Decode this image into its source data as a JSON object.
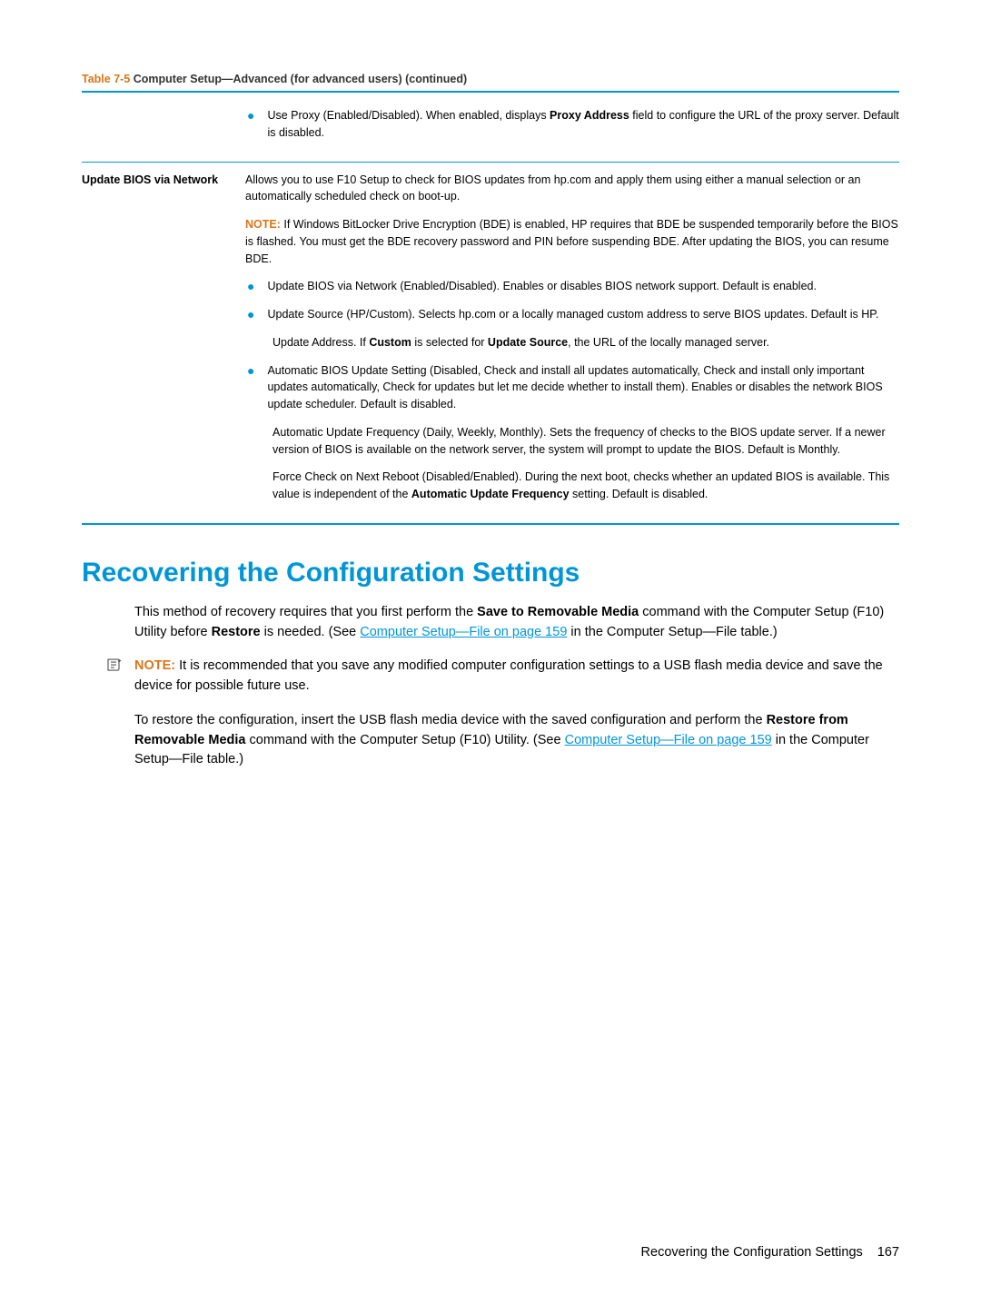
{
  "tableCaption": {
    "prefix": "Table 7-5",
    "title": "  Computer Setup—Advanced (for advanced users) (continued)"
  },
  "row1": {
    "bullet1": {
      "pre": "Use Proxy (Enabled/Disabled). When enabled, displays ",
      "bold": "Proxy Address",
      "post": " field to configure the URL of the proxy server. Default is disabled."
    }
  },
  "row2": {
    "label": "Update BIOS via Network",
    "intro": "Allows you to use F10 Setup to check for BIOS updates from hp.com and apply them using either a manual selection or an automatically scheduled check on boot-up.",
    "noteLabel": "NOTE:",
    "noteText": "   If Windows BitLocker Drive Encryption (BDE) is enabled, HP requires that BDE be suspended temporarily before the BIOS is flashed. You must get the BDE recovery password and PIN before suspending BDE. After updating the BIOS, you can resume BDE.",
    "b1": "Update BIOS via Network (Enabled/Disabled). Enables or disables BIOS network support. Default is enabled.",
    "b2": "Update Source (HP/Custom). Selects hp.com or a locally managed custom address to serve BIOS updates. Default is HP.",
    "addr": {
      "pre": "Update Address. If ",
      "b1": "Custom",
      "mid": " is selected for ",
      "b2": "Update Source",
      "post": ", the URL of the locally managed server."
    },
    "b3": "Automatic BIOS Update Setting (Disabled, Check and install all updates automatically, Check and install only important updates automatically, Check for updates but let me decide whether to install them). Enables or disables the network BIOS update scheduler. Default is disabled.",
    "freq": "Automatic Update Frequency (Daily, Weekly, Monthly). Sets the frequency of checks to the BIOS update server. If a newer version of BIOS is available on the network server, the system will prompt to update the BIOS. Default is Monthly.",
    "force": {
      "pre": "Force Check on Next Reboot (Disabled/Enabled). During the next boot, checks whether an updated BIOS is available. This value is independent of the ",
      "bold": "Automatic Update Frequency",
      "post": " setting. Default is disabled."
    }
  },
  "heading": "Recovering the Configuration Settings",
  "p1": {
    "pre": "This method of recovery requires that you first perform the ",
    "b1": "Save to Removable Media",
    "mid1": " command with the Computer Setup (F10) Utility before ",
    "b2": "Restore",
    "mid2": " is needed. (See ",
    "link": "Computer Setup—File on page 159",
    "post": " in the Computer Setup—File table.)"
  },
  "note2": {
    "label": "NOTE:",
    "text": "   It is recommended that you save any modified computer configuration settings to a USB flash media device and save the device for possible future use."
  },
  "p2": {
    "pre": "To restore the configuration, insert the USB flash media device with the saved configuration and perform the ",
    "b1": "Restore from Removable Media",
    "mid": " command with the Computer Setup (F10) Utility. (See ",
    "link": "Computer Setup—File on page 159",
    "post": " in the Computer Setup—File table.)"
  },
  "footer": {
    "text": "Recovering the Configuration Settings",
    "page": "167"
  }
}
